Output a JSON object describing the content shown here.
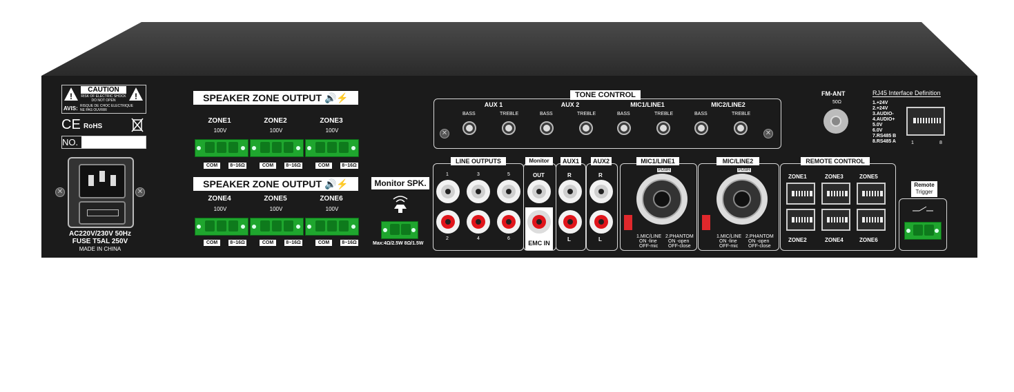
{
  "caution": {
    "title": "CAUTION",
    "line1": "RISK OF ELECTRIC SHOCK",
    "line2": "DO NOT OPEN",
    "avis_label": "AVIS:",
    "avis_line1": "RISQUE DE CHOC ELECTRIQUE",
    "avis_line2": "NE PAS OUVRIR",
    "ce": "CE",
    "rohs": "RoHS",
    "serial_label": "NO."
  },
  "power": {
    "line1": "AC220V/230V 50Hz",
    "line2": "FUSE  T5AL 250V",
    "line3": "MADE IN  CHINA"
  },
  "speaker_output": {
    "title": "SPEAKER ZONE OUTPUT",
    "voltage": "100V",
    "com_label": "COM",
    "ohm_label": "8~16Ω",
    "zones_top": [
      "ZONE1",
      "ZONE2",
      "ZONE3"
    ],
    "zones_bottom": [
      "ZONE4",
      "ZONE5",
      "ZONE6"
    ]
  },
  "monitor_spk": {
    "title": "Monitor SPK.",
    "spec": "Max:4Ω/2.5W 8Ω/1.5W"
  },
  "line_outputs": {
    "title": "LINE OUTPUTS",
    "top": [
      "1",
      "3",
      "5"
    ],
    "bottom": [
      "2",
      "4",
      "6"
    ]
  },
  "monitor_out": {
    "title": "Monitor",
    "out_label": "OUT",
    "emc_label": "EMC IN"
  },
  "aux1": {
    "title": "AUX1",
    "r": "R",
    "l": "L"
  },
  "aux2": {
    "title": "AUX2",
    "r": "R",
    "l": "L"
  },
  "tone_control": {
    "title": "TONE CONTROL",
    "groups": [
      {
        "name": "AUX 1",
        "bass": "BASS",
        "treble": "TREBLE"
      },
      {
        "name": "AUX 2",
        "bass": "BASS",
        "treble": "TREBLE"
      },
      {
        "name": "MIC1/LINE1",
        "bass": "BASS",
        "treble": "TREBLE"
      },
      {
        "name": "MIC2/LINE2",
        "bass": "BASS",
        "treble": "TREBLE"
      }
    ]
  },
  "mic1": {
    "title": "MIC1/LINE1",
    "push": "PUSH",
    "note1": "1.MIC/LINE",
    "note2": "ON -line",
    "note3": "OFF-mic",
    "note4": "2.PHANTOM",
    "note5": "ON -open",
    "note6": "OFF-close"
  },
  "mic2": {
    "title": "MIC/LINE2",
    "push": "PUSH",
    "note1": "1.MIC/LINE",
    "note2": "ON -line",
    "note3": "OFF-mic",
    "note4": "2.PHANTOM",
    "note5": "ON -open",
    "note6": "OFF-close"
  },
  "fm_ant": {
    "title": "FM-ANT",
    "ohm": "50Ω"
  },
  "rj45_def": {
    "title": "RJ45 Interface Definition",
    "pins": [
      "1.+24V",
      "2.+24V",
      "3.AUDIO-",
      "4.AUDIO+",
      "5.0V",
      "6.0V",
      "7.RS485 B",
      "8.RS485 A"
    ],
    "pin_first": "1",
    "pin_last": "8"
  },
  "remote_control": {
    "title": "REMOTE CONTROL",
    "top": [
      "ZONE1",
      "ZONE3",
      "ZONE5"
    ],
    "bottom": [
      "ZONE2",
      "ZONE4",
      "ZONE6"
    ]
  },
  "remote_trigger": {
    "line1": "Remote",
    "line2": "Trigger"
  }
}
